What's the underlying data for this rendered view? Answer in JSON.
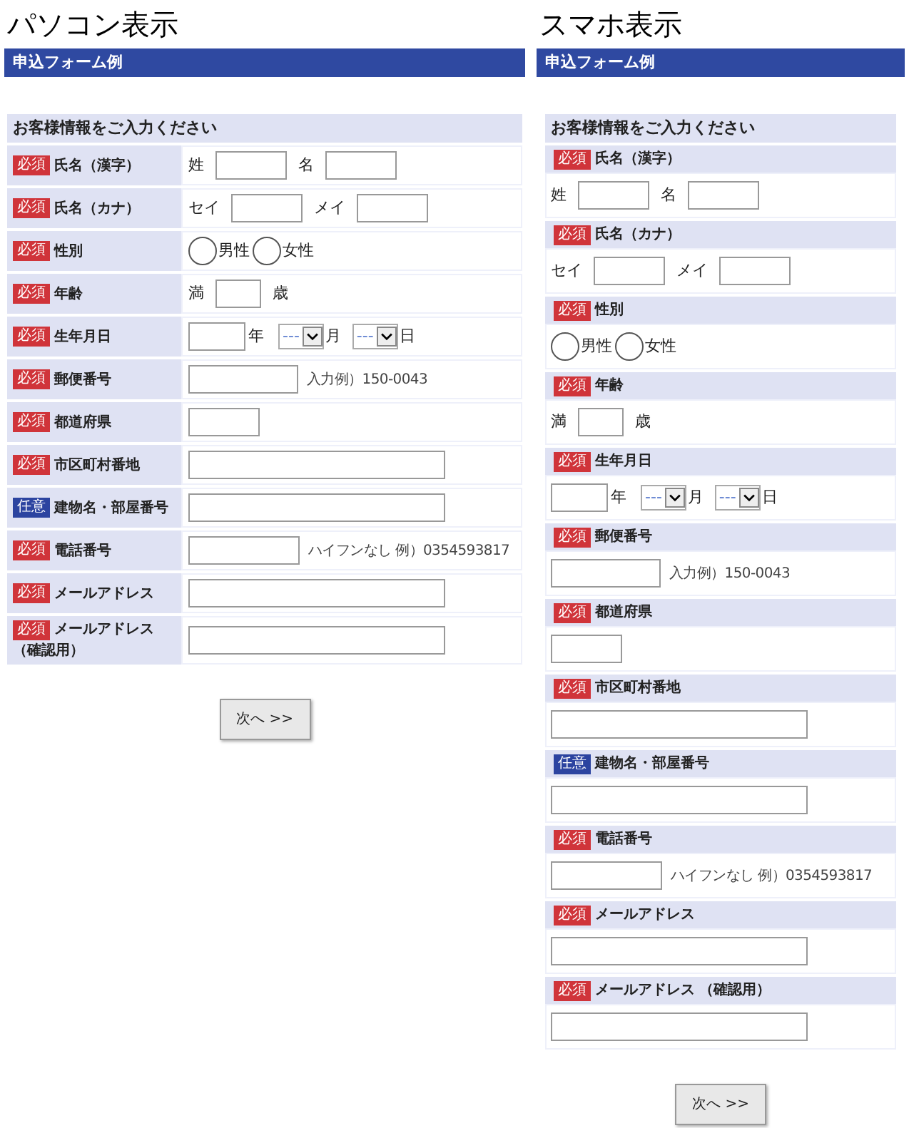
{
  "panels": [
    {
      "kind": "table",
      "title": "パソコン表示",
      "form_title": "申込フォーム例",
      "section_heading": "お客様情報をご入力ください",
      "button": "次へ >>",
      "fields": [
        {
          "badge": {
            "text": "必須",
            "kind": "required"
          },
          "label": "氏名（漢字）",
          "input": {
            "kind": "pair",
            "parts": [
              {
                "prefix": "姓"
              },
              {
                "prefix": "名"
              }
            ]
          }
        },
        {
          "badge": {
            "text": "必須",
            "kind": "required"
          },
          "label": "氏名（カナ）",
          "input": {
            "kind": "pair",
            "parts": [
              {
                "prefix": "セイ"
              },
              {
                "prefix": "メイ"
              }
            ]
          }
        },
        {
          "badge": {
            "text": "必須",
            "kind": "required"
          },
          "label": "性別",
          "input": {
            "kind": "radio",
            "options": [
              {
                "label": "男性",
                "selected": false
              },
              {
                "label": "女性",
                "selected": false
              }
            ]
          }
        },
        {
          "badge": {
            "text": "必須",
            "kind": "required"
          },
          "label": "年齢",
          "input": {
            "kind": "age",
            "prefix": "満",
            "suffix": "歳"
          }
        },
        {
          "badge": {
            "text": "必須",
            "kind": "required"
          },
          "label": "生年月日",
          "input": {
            "kind": "date",
            "year_suffix": "年",
            "selects": [
              {
                "value": "---",
                "suffix": "月"
              },
              {
                "value": "---",
                "suffix": "日"
              }
            ]
          }
        },
        {
          "badge": {
            "text": "必須",
            "kind": "required"
          },
          "label": "郵便番号",
          "input": {
            "kind": "medium_text",
            "hint": "入力例）150-0043"
          }
        },
        {
          "badge": {
            "text": "必須",
            "kind": "required"
          },
          "label": "都道府県",
          "input": {
            "kind": "short_text"
          }
        },
        {
          "badge": {
            "text": "必須",
            "kind": "required"
          },
          "label": "市区町村番地",
          "input": {
            "kind": "long_text"
          }
        },
        {
          "badge": {
            "text": "任意",
            "kind": "optional"
          },
          "label": "建物名・部屋番号",
          "input": {
            "kind": "long_text"
          }
        },
        {
          "badge": {
            "text": "必須",
            "kind": "required"
          },
          "label": "電話番号",
          "input": {
            "kind": "phone_text",
            "hint": "ハイフンなし 例）0354593817"
          }
        },
        {
          "badge": {
            "text": "必須",
            "kind": "required"
          },
          "label": "メールアドレス",
          "input": {
            "kind": "long_text"
          }
        },
        {
          "badge": {
            "text": "必須",
            "kind": "required"
          },
          "label": "メールアドレス",
          "note": "（確認用）",
          "input": {
            "kind": "long_text"
          }
        }
      ]
    },
    {
      "kind": "stacked",
      "title": "スマホ表示",
      "form_title": "申込フォーム例",
      "section_heading": "お客様情報をご入力ください",
      "button": "次へ >>",
      "fields": [
        {
          "badge": {
            "text": "必須",
            "kind": "required"
          },
          "label": "氏名（漢字）",
          "input": {
            "kind": "pair",
            "parts": [
              {
                "prefix": "姓"
              },
              {
                "prefix": "名"
              }
            ]
          }
        },
        {
          "badge": {
            "text": "必須",
            "kind": "required"
          },
          "label": "氏名（カナ）",
          "input": {
            "kind": "pair",
            "parts": [
              {
                "prefix": "セイ"
              },
              {
                "prefix": "メイ"
              }
            ]
          }
        },
        {
          "badge": {
            "text": "必須",
            "kind": "required"
          },
          "label": "性別",
          "input": {
            "kind": "radio",
            "options": [
              {
                "label": "男性",
                "selected": false
              },
              {
                "label": "女性",
                "selected": false
              }
            ]
          }
        },
        {
          "badge": {
            "text": "必須",
            "kind": "required"
          },
          "label": "年齢",
          "input": {
            "kind": "age",
            "prefix": "満",
            "suffix": "歳"
          }
        },
        {
          "badge": {
            "text": "必須",
            "kind": "required"
          },
          "label": "生年月日",
          "input": {
            "kind": "date",
            "year_suffix": "年",
            "selects": [
              {
                "value": "---",
                "suffix": "月"
              },
              {
                "value": "---",
                "suffix": "日"
              }
            ]
          }
        },
        {
          "badge": {
            "text": "必須",
            "kind": "required"
          },
          "label": "郵便番号",
          "input": {
            "kind": "medium_text",
            "hint": "入力例）150-0043"
          }
        },
        {
          "badge": {
            "text": "必須",
            "kind": "required"
          },
          "label": "都道府県",
          "input": {
            "kind": "short_text"
          }
        },
        {
          "badge": {
            "text": "必須",
            "kind": "required"
          },
          "label": "市区町村番地",
          "input": {
            "kind": "long_text"
          }
        },
        {
          "badge": {
            "text": "任意",
            "kind": "optional"
          },
          "label": "建物名・部屋番号",
          "input": {
            "kind": "long_text"
          }
        },
        {
          "badge": {
            "text": "必須",
            "kind": "required"
          },
          "label": "電話番号",
          "input": {
            "kind": "phone_text",
            "hint": "ハイフンなし 例）0354593817"
          }
        },
        {
          "badge": {
            "text": "必須",
            "kind": "required"
          },
          "label": "メールアドレス",
          "input": {
            "kind": "long_text"
          }
        },
        {
          "badge": {
            "text": "必須",
            "kind": "required"
          },
          "label": "メールアドレス",
          "note": "（確認用）",
          "input": {
            "kind": "long_text"
          }
        }
      ]
    }
  ]
}
